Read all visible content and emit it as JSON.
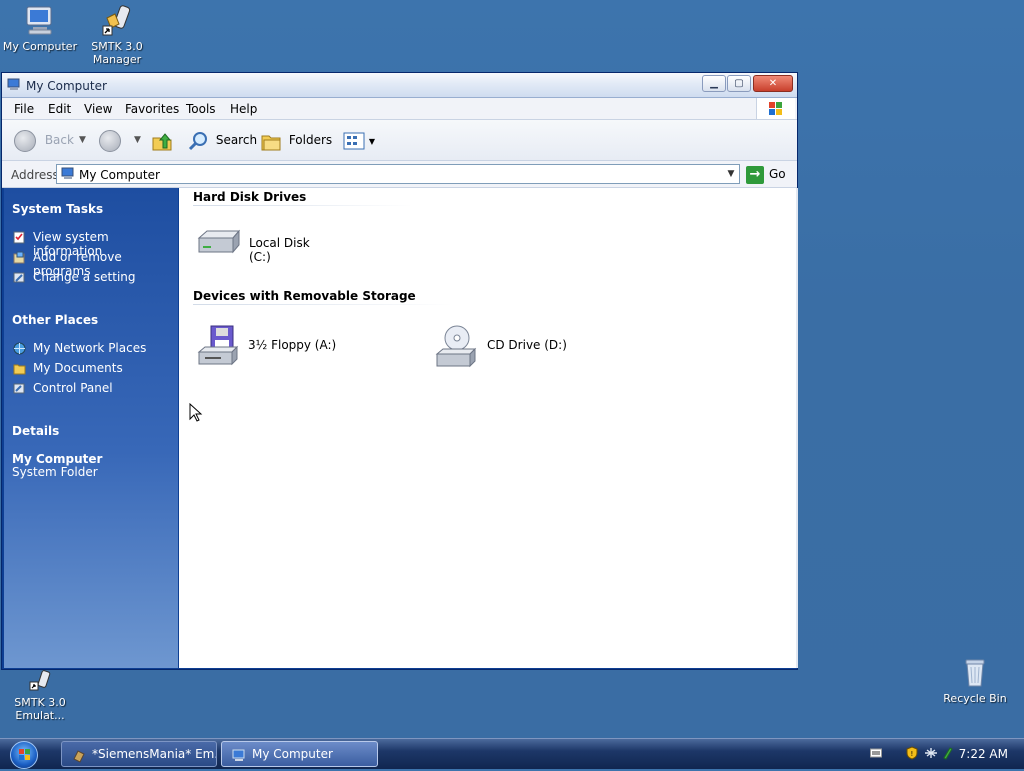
{
  "desktop": {
    "icons": [
      {
        "label_line1": "My Computer",
        "label_line2": ""
      },
      {
        "label_line1": "SMTK 3.0",
        "label_line2": "Manager"
      },
      {
        "label_line1": "SMTK 3.0",
        "label_line2": "Emulat..."
      },
      {
        "label_line1": "Recycle Bin",
        "label_line2": ""
      }
    ]
  },
  "window": {
    "title": "My Computer",
    "menu": [
      "File",
      "Edit",
      "View",
      "Favorites",
      "Tools",
      "Help"
    ],
    "toolbar": {
      "back": "Back",
      "search": "Search",
      "folders": "Folders"
    },
    "address": {
      "label": "Address",
      "value": "My Computer",
      "go": "Go"
    },
    "taskpane": {
      "system_tasks": {
        "heading": "System Tasks",
        "items": [
          "View system information",
          "Add or remove programs",
          "Change a setting"
        ]
      },
      "other_places": {
        "heading": "Other Places",
        "items": [
          "My Network Places",
          "My Documents",
          "Control Panel"
        ]
      },
      "details": {
        "heading": "Details",
        "name": "My Computer",
        "type": "System Folder"
      }
    },
    "content": {
      "groups": [
        {
          "heading": "Hard Disk Drives",
          "items": [
            "Local Disk (C:)"
          ]
        },
        {
          "heading": "Devices with Removable Storage",
          "items": [
            "3½ Floppy (A:)",
            "CD Drive (D:)"
          ]
        }
      ]
    }
  },
  "taskbar": {
    "buttons": [
      "*SiemensMania* Em...",
      "My Computer"
    ],
    "clock": "7:22 AM"
  },
  "colors": {
    "desktop": "#3a6ea5",
    "taskpane_top": "#1e4ea1",
    "taskbar": "#1d3768",
    "close_button": "#c8402d"
  }
}
